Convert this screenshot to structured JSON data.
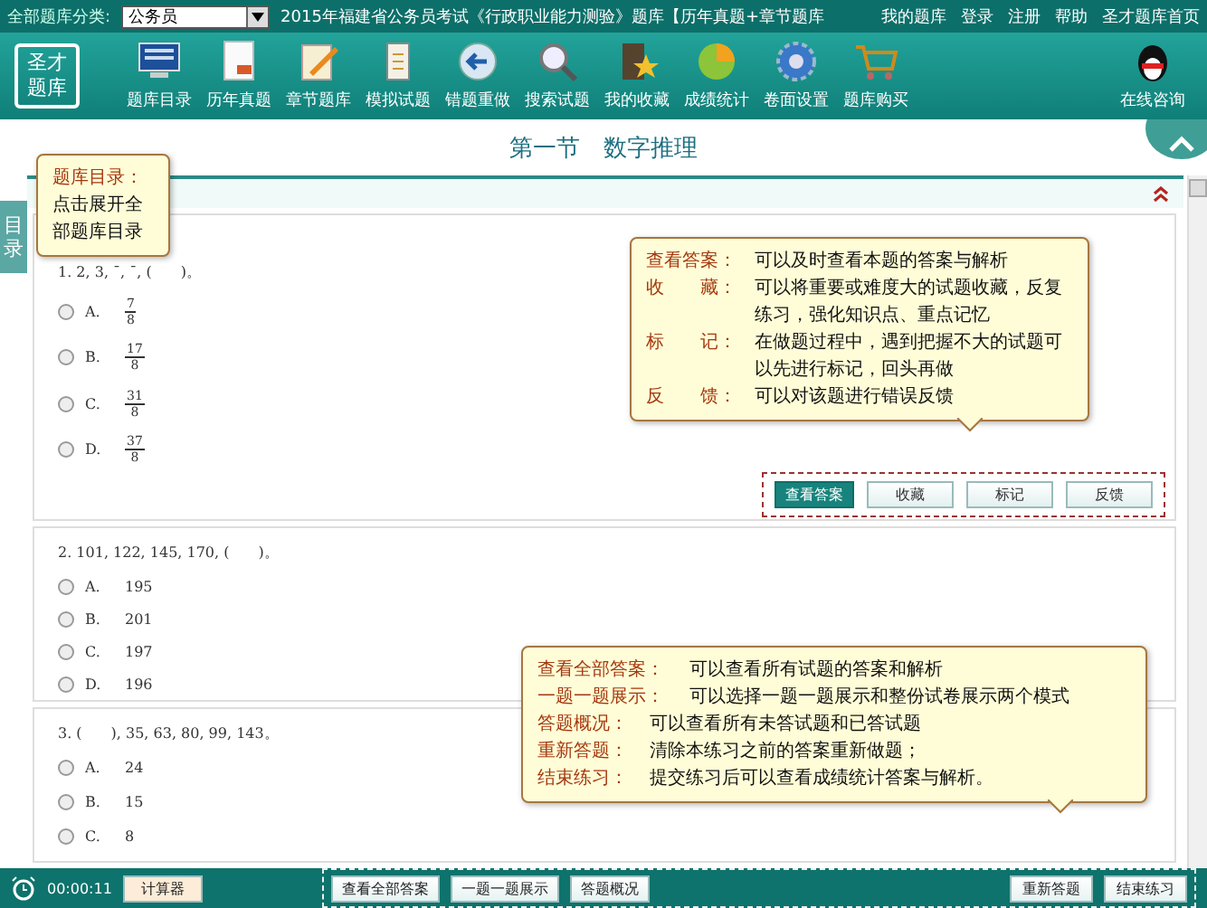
{
  "top_bar": {
    "category_label": "全部题库分类:",
    "category_value": "公务员",
    "exam_title": "2015年福建省公务员考试《行政职业能力测验》题库【历年真题+章节题库",
    "links": [
      "我的题库",
      "登录",
      "注册",
      "帮助",
      "圣才题库首页"
    ]
  },
  "logo": {
    "lines": [
      "圣才",
      "题库"
    ]
  },
  "toolbar": [
    {
      "label": "题库目录"
    },
    {
      "label": "历年真题"
    },
    {
      "label": "章节题库"
    },
    {
      "label": "模拟试题"
    },
    {
      "label": "错题重做"
    },
    {
      "label": "搜索试题"
    },
    {
      "label": "我的收藏"
    },
    {
      "label": "成绩统计"
    },
    {
      "label": "卷面设置"
    },
    {
      "label": "题库购买"
    }
  ],
  "consult": {
    "label": "在线咨询"
  },
  "section_title": "第一节　数字推理",
  "side_tab": "目录",
  "questions": [
    {
      "stem": "1. 2, 3, ˉ, ˉ, (　　)。",
      "options": [
        {
          "letter": "A.",
          "kind": "fraction",
          "numerator": "7",
          "denominator": "8",
          "selected": false
        },
        {
          "letter": "B.",
          "kind": "fraction",
          "numerator": "17",
          "denominator": "8",
          "selected": false
        },
        {
          "letter": "C.",
          "kind": "fraction",
          "numerator": "31",
          "denominator": "8",
          "selected": false
        },
        {
          "letter": "D.",
          "kind": "fraction",
          "numerator": "37",
          "denominator": "8",
          "selected": false
        }
      ],
      "actions": [
        {
          "label": "查看答案",
          "primary": true
        },
        {
          "label": "收藏",
          "primary": false
        },
        {
          "label": "标记",
          "primary": false
        },
        {
          "label": "反馈",
          "primary": false
        }
      ]
    },
    {
      "stem": "2. 101, 122, 145, 170, (　　)。",
      "options": [
        {
          "letter": "A.",
          "kind": "plain",
          "value": "195",
          "selected": false
        },
        {
          "letter": "B.",
          "kind": "plain",
          "value": "201",
          "selected": false
        },
        {
          "letter": "C.",
          "kind": "plain",
          "value": "197",
          "selected": false
        },
        {
          "letter": "D.",
          "kind": "plain",
          "value": "196",
          "selected": false
        }
      ]
    },
    {
      "stem": "3. (　　), 35, 63, 80, 99, 143。",
      "options": [
        {
          "letter": "A.",
          "kind": "plain",
          "value": "24",
          "selected": false
        },
        {
          "letter": "B.",
          "kind": "plain",
          "value": "15",
          "selected": false
        },
        {
          "letter": "C.",
          "kind": "plain",
          "value": "8",
          "selected": false
        }
      ]
    }
  ],
  "toc_tip": {
    "term": "题库目录：",
    "text": "点击展开全部题库目录"
  },
  "answer_tip": [
    {
      "term": "查看答案：",
      "text": "可以及时查看本题的答案与解析"
    },
    {
      "term": "收　　藏：",
      "text": "可以将重要或难度大的试题收藏，反复练习，强化知识点、重点记忆"
    },
    {
      "term": "标　　记：",
      "text": "在做题过程中，遇到把握不大的试题可以先进行标记，回头再做"
    },
    {
      "term": "反　　馈：",
      "text": "可以对该题进行错误反馈"
    }
  ],
  "bottom_tip": [
    {
      "term": "查看全部答案：",
      "text": "可以查看所有试题的答案和解析"
    },
    {
      "term": "一题一题展示：",
      "text": "可以选择一题一题展示和整份试卷展示两个模式"
    },
    {
      "term": "答题概况：",
      "text": "可以查看所有未答试题和已答试题"
    },
    {
      "term": "重新答题：",
      "text": "清除本练习之前的答案重新做题；"
    },
    {
      "term": "结束练习：",
      "text": "提交练习后可以查看成绩统计答案与解析。"
    }
  ],
  "bottom_bar": {
    "timer": "00:00:11",
    "calculator": "计算器",
    "middle_buttons": [
      "查看全部答案",
      "一题一题展示",
      "答题概况"
    ],
    "right_buttons": [
      "重新答题",
      "结束练习"
    ]
  }
}
